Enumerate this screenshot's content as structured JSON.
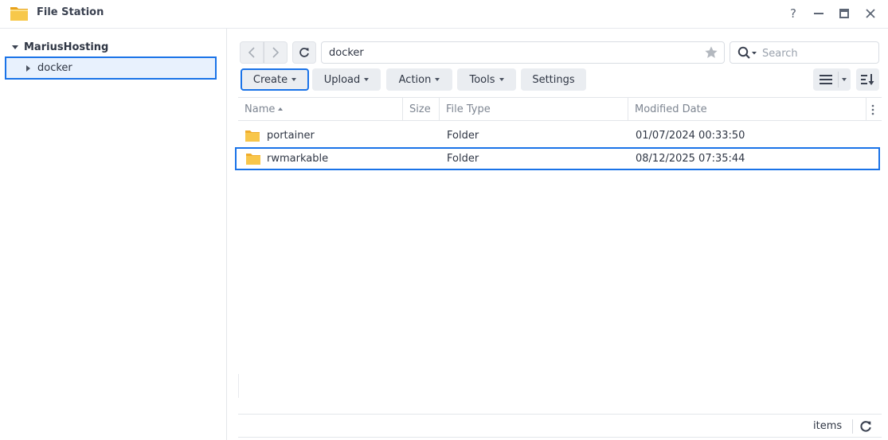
{
  "window": {
    "title": "File Station",
    "help_label": "?"
  },
  "tree": {
    "root_label": "MariusHosting",
    "items": [
      {
        "label": "docker"
      }
    ]
  },
  "toolbar": {
    "path": "docker",
    "search_placeholder": "Search",
    "create_label": "Create",
    "upload_label": "Upload",
    "action_label": "Action",
    "tools_label": "Tools",
    "settings_label": "Settings"
  },
  "table": {
    "columns": {
      "name": "Name",
      "size": "Size",
      "type": "File Type",
      "date": "Modified Date"
    },
    "rows": [
      {
        "name": "portainer",
        "size": "",
        "type": "Folder",
        "date": "01/07/2024 00:33:50"
      },
      {
        "name": "rwmarkable",
        "size": "",
        "type": "Folder",
        "date": "08/12/2025 07:35:44"
      }
    ]
  },
  "footer": {
    "items_label": "items"
  },
  "colors": {
    "accent": "#1a73e8",
    "folder": "#f6c143",
    "button_bg": "#eaedf1"
  }
}
